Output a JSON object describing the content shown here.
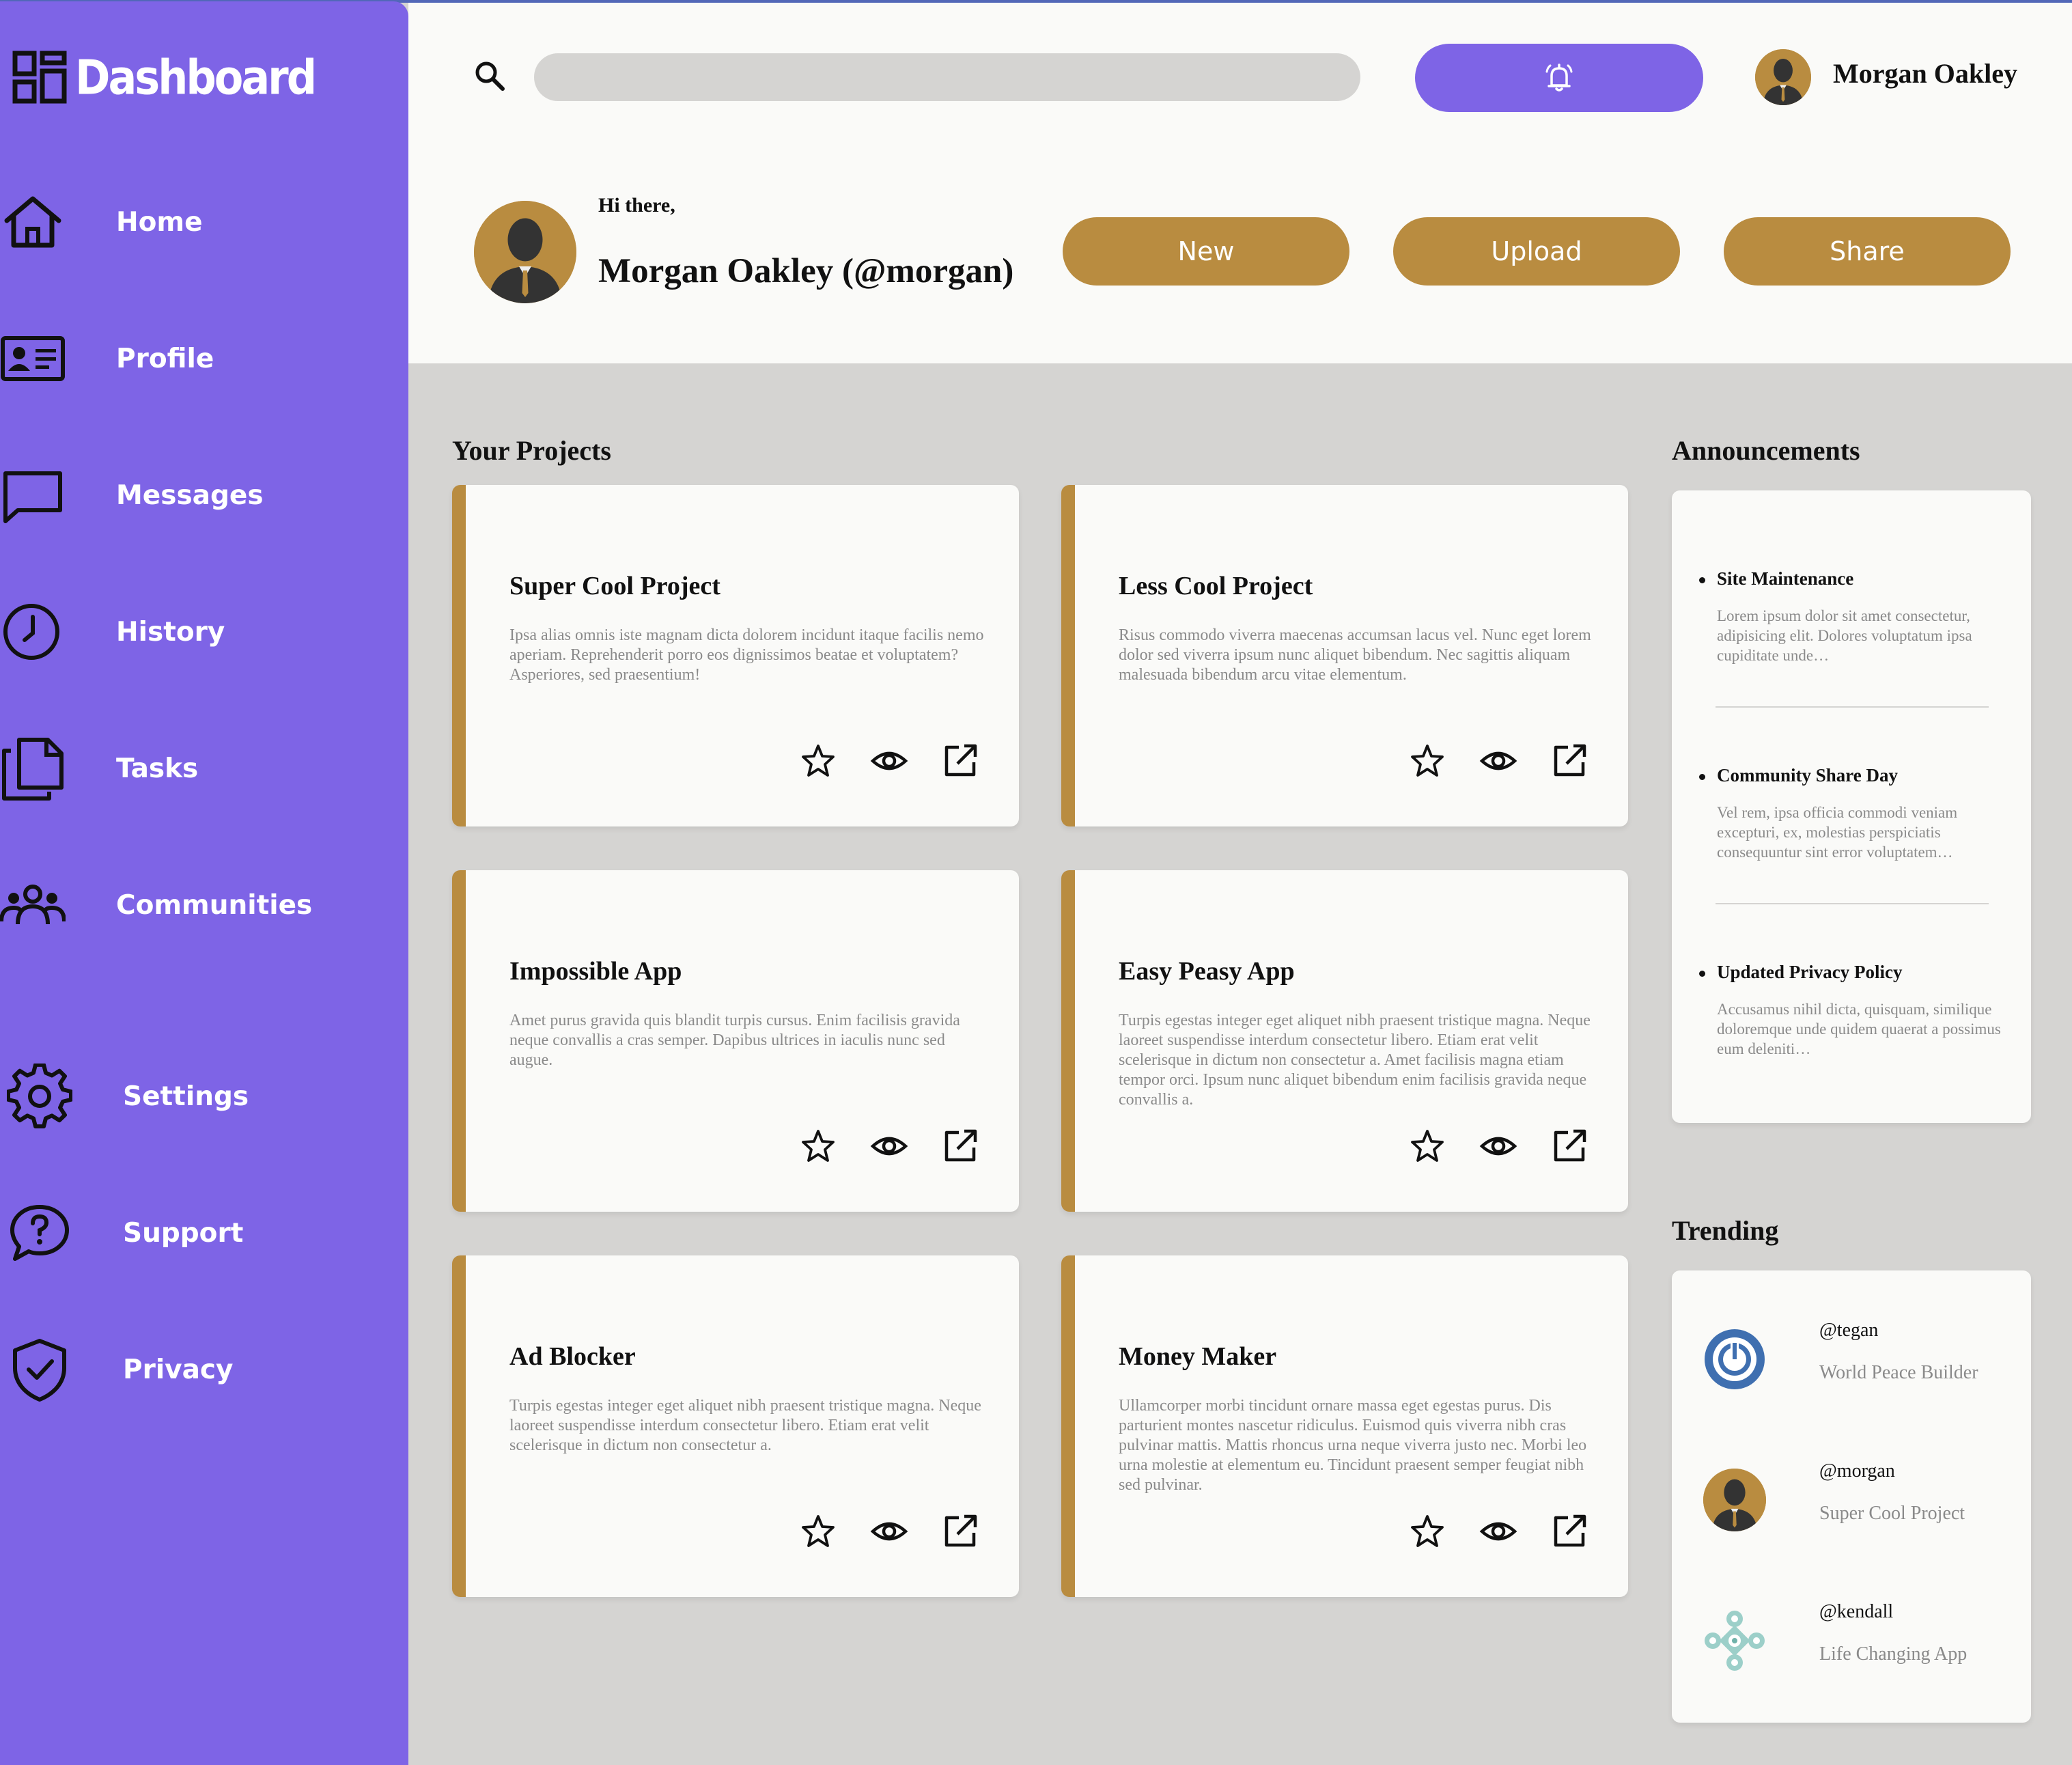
{
  "app": {
    "title": "Dashboard"
  },
  "sidebar": {
    "items": [
      {
        "label": "Home",
        "icon": "home-icon"
      },
      {
        "label": "Profile",
        "icon": "profile-card-icon"
      },
      {
        "label": "Messages",
        "icon": "message-icon"
      },
      {
        "label": "History",
        "icon": "clock-icon"
      },
      {
        "label": "Tasks",
        "icon": "documents-icon"
      },
      {
        "label": "Communities",
        "icon": "people-icon"
      },
      {
        "label": "Settings",
        "icon": "gear-icon"
      },
      {
        "label": "Support",
        "icon": "help-icon"
      },
      {
        "label": "Privacy",
        "icon": "shield-icon"
      }
    ]
  },
  "header": {
    "search": {
      "placeholder": "",
      "value": ""
    },
    "notification_icon": "bell-icon",
    "user_name": "Morgan Oakley",
    "greeting": "Hi there,",
    "full_name": "Morgan Oakley (@morgan)",
    "actions": {
      "new": "New",
      "upload": "Upload",
      "share": "Share"
    }
  },
  "colors": {
    "accent": "#7e64e6",
    "gold": "#b98c40",
    "background": "#d5d4d2",
    "surface": "#fafaf8"
  },
  "projects": {
    "title": "Your Projects",
    "items": [
      {
        "title": "Super Cool Project",
        "desc": "Ipsa alias omnis iste magnam dicta dolorem incidunt itaque facilis nemo aperiam. Reprehenderit porro eos dignissimos beatae et voluptatem? Asperiores, sed praesentium!"
      },
      {
        "title": "Less Cool Project",
        "desc": "Risus commodo viverra maecenas accumsan lacus vel. Nunc eget lorem dolor sed viverra ipsum nunc aliquet bibendum. Nec sagittis aliquam malesuada bibendum arcu vitae elementum."
      },
      {
        "title": "Impossible App",
        "desc": "Amet purus gravida quis blandit turpis cursus. Enim facilisis gravida neque convallis a cras semper. Dapibus ultrices in iaculis nunc sed augue."
      },
      {
        "title": "Easy Peasy App",
        "desc": "Turpis egestas integer eget aliquet nibh praesent tristique magna. Neque laoreet suspendisse interdum consectetur libero. Etiam erat velit scelerisque in dictum non consectetur a. Amet facilisis magna etiam tempor orci. Ipsum nunc aliquet bibendum enim facilisis gravida neque convallis a."
      },
      {
        "title": "Ad Blocker",
        "desc": "Turpis egestas integer eget aliquet nibh praesent tristique magna. Neque laoreet suspendisse interdum consectetur libero. Etiam erat velit scelerisque in dictum non consectetur a."
      },
      {
        "title": "Money Maker",
        "desc": "Ullamcorper morbi tincidunt ornare massa eget egestas purus. Dis parturient montes nascetur ridiculus. Euismod quis viverra nibh cras pulvinar mattis. Mattis rhoncus urna neque viverra justo nec. Morbi leo urna molestie at elementum eu. Tincidunt praesent semper feugiat nibh sed pulvinar."
      }
    ]
  },
  "announcements": {
    "title": "Announcements",
    "items": [
      {
        "title": "Site Maintenance",
        "text": "Lorem ipsum dolor sit amet consectetur, adipisicing elit. Dolores voluptatum ipsa cupiditate unde…"
      },
      {
        "title": "Community Share Day",
        "text": "Vel rem, ipsa officia commodi veniam excepturi, ex, molestias perspiciatis consequuntur sint error voluptatem…"
      },
      {
        "title": "Updated Privacy Policy",
        "text": "Accusamus nihil dicta, quisquam, similique doloremque unde quidem quaerat a possimus eum deleniti…"
      }
    ]
  },
  "trending": {
    "title": "Trending",
    "items": [
      {
        "handle": "@tegan",
        "project": "World Peace Builder",
        "avatar": "power-logo-icon"
      },
      {
        "handle": "@morgan",
        "project": "Super Cool Project",
        "avatar": "user-avatar"
      },
      {
        "handle": "@kendall",
        "project": "Life Changing App",
        "avatar": "pattern-logo-icon"
      }
    ]
  }
}
